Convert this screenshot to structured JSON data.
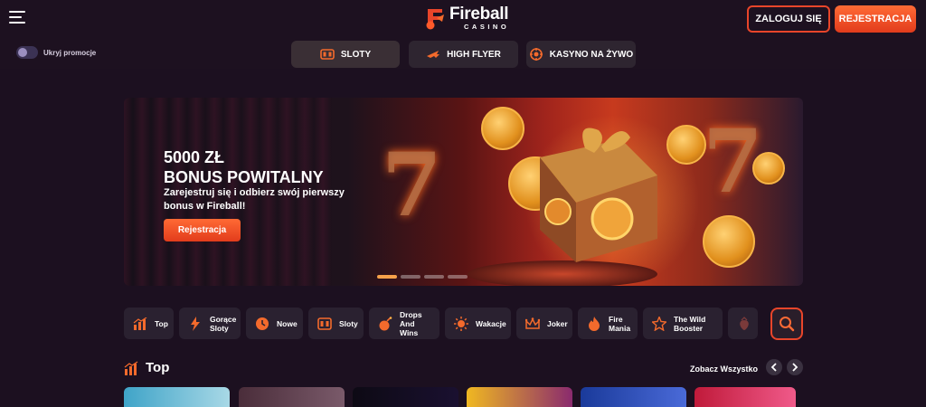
{
  "header": {
    "logo_title": "Fireball",
    "logo_subtitle": "CASINO",
    "login_label": "ZALOGUJ SIĘ",
    "register_label": "REJESTRACJA"
  },
  "subnav": {
    "toggle_label": "Ukryj promocje",
    "tabs": [
      {
        "label": "SLOTY",
        "icon": "slot-machine-icon"
      },
      {
        "label": "HIGH FLYER",
        "icon": "plane-icon"
      },
      {
        "label": "KASYNO NA ŻYWO",
        "icon": "roulette-icon"
      }
    ]
  },
  "hero": {
    "title_line1": "5000 ZŁ",
    "title_line2": "BONUS POWITALNY",
    "description": "Zarejestruj się i odbierz swój pierwszy bonus w Fireball!",
    "button_label": "Rejestracja",
    "slide_count": 4,
    "active_slide": 1
  },
  "categories": [
    {
      "label": "Top",
      "icon": "chart-bars-icon"
    },
    {
      "label": "Gorące Sloty",
      "icon": "lightning-icon"
    },
    {
      "label": "Nowe",
      "icon": "clock-icon"
    },
    {
      "label": "Sloty",
      "icon": "slot-machine-icon"
    },
    {
      "label": "Drops And Wins",
      "icon": "bomb-icon"
    },
    {
      "label": "Wakacje",
      "icon": "sun-icon"
    },
    {
      "label": "Joker",
      "icon": "jester-hat-icon"
    },
    {
      "label": "Fire Mania",
      "icon": "flame-icon"
    },
    {
      "label": "The Wild Booster",
      "icon": "star-icon"
    }
  ],
  "top_section": {
    "title": "Top",
    "see_all_label": "Zobacz Wszystko"
  },
  "colors": {
    "accent": "#e8452a",
    "background": "#1c1020",
    "card": "#2a2130"
  }
}
